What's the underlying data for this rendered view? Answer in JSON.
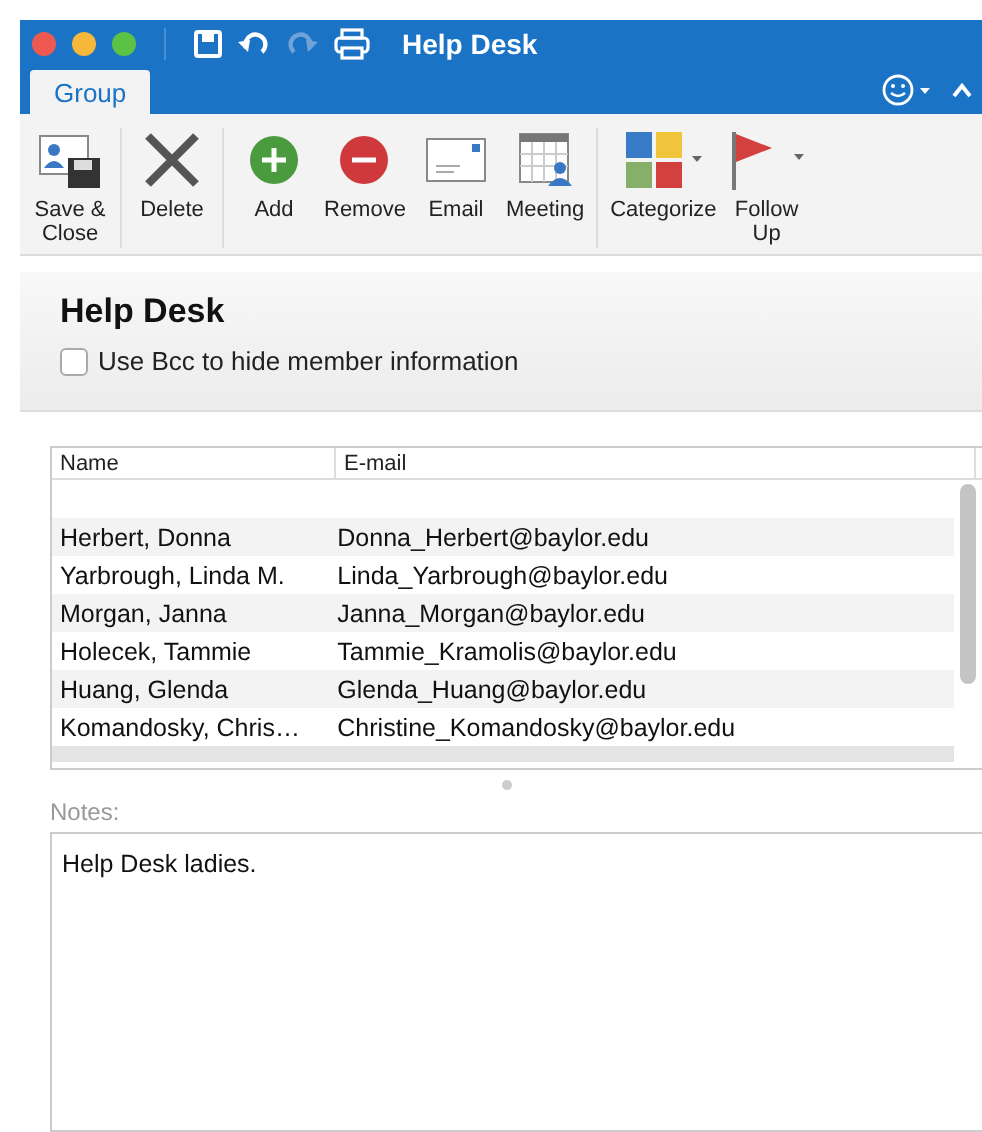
{
  "window": {
    "title": "Help Desk"
  },
  "tabs": [
    {
      "label": "Group",
      "selected": true
    }
  ],
  "ribbon": [
    {
      "buttons": [
        {
          "kind": "save",
          "label": "Save &\nClose"
        }
      ]
    },
    {
      "buttons": [
        {
          "kind": "delete",
          "label": "Delete"
        }
      ]
    },
    {
      "buttons": [
        {
          "kind": "add",
          "label": "Add"
        },
        {
          "kind": "remove",
          "label": "Remove"
        },
        {
          "kind": "email",
          "label": "Email"
        },
        {
          "kind": "meeting",
          "label": "Meeting"
        }
      ]
    },
    {
      "buttons": [
        {
          "kind": "categorize",
          "label": "Categorize"
        },
        {
          "kind": "flag",
          "label": "Follow\nUp"
        }
      ]
    }
  ],
  "header": {
    "title": "Help Desk",
    "bcc": {
      "label": "Use Bcc to hide member information",
      "checked": false
    }
  },
  "table": {
    "columns": [
      "Name",
      "E-mail"
    ],
    "rows": [
      [
        "Herbert, Donna",
        "Donna_Herbert@baylor.edu"
      ],
      [
        "Yarbrough, Linda M.",
        "Linda_Yarbrough@baylor.edu"
      ],
      [
        "Morgan, Janna",
        "Janna_Morgan@baylor.edu"
      ],
      [
        "Holecek, Tammie",
        "Tammie_Kramolis@baylor.edu"
      ],
      [
        "Huang, Glenda",
        "Glenda_Huang@baylor.edu"
      ],
      [
        "Komandosky, Chris…",
        "Christine_Komandosky@baylor.edu"
      ]
    ]
  },
  "notes": {
    "label": "Notes:",
    "value": "Help Desk ladies."
  }
}
